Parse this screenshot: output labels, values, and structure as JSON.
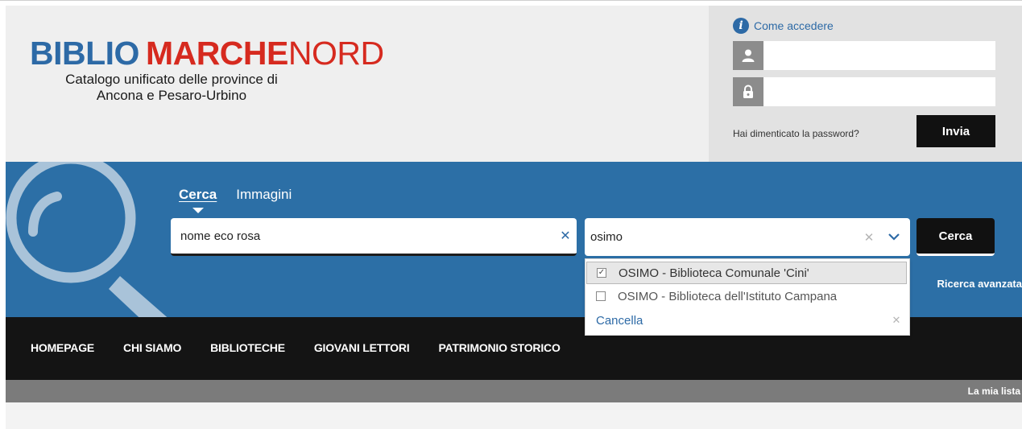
{
  "header": {
    "logo": {
      "part1": "BIBLIO",
      "part2": "MARCHE",
      "part3": "NORD"
    },
    "subtitle_line1": "Catalogo unificato delle province di",
    "subtitle_line2": "Ancona e Pesaro-Urbino"
  },
  "login": {
    "info_link": "Come accedere",
    "username_value": "",
    "password_value": "",
    "forgot_password": "Hai dimenticato la password?",
    "submit_label": "Invia"
  },
  "search": {
    "tabs": [
      {
        "label": "Cerca",
        "active": true
      },
      {
        "label": "Immagini",
        "active": false
      }
    ],
    "query_value": "nome eco rosa",
    "clear_symbol": "✕",
    "library_value": "osimo",
    "search_button": "Cerca",
    "advanced_link": "Ricerca avanzata"
  },
  "dropdown": {
    "options": [
      {
        "label": "OSIMO - Biblioteca Comunale 'Cini'",
        "checked": true
      },
      {
        "label": "OSIMO - Biblioteca dell'Istituto Campana",
        "checked": false
      }
    ],
    "cancel_label": "Cancella"
  },
  "nav": {
    "items": [
      "HOMEPAGE",
      "CHI SIAMO",
      "BIBLIOTECHE",
      "GIOVANI LETTORI",
      "PATRIMONIO STORICO"
    ]
  },
  "subbar": {
    "my_list": "La mia lista"
  },
  "colors": {
    "brand_blue": "#2d6aa6",
    "brand_red": "#d62a1f",
    "band_blue": "#2c6fa6",
    "nav_black": "#141414"
  },
  "icons": [
    "info-icon",
    "user-icon",
    "lock-icon",
    "magnifier-icon",
    "clear-icon",
    "chevron-down-icon",
    "checkbox-icon"
  ]
}
